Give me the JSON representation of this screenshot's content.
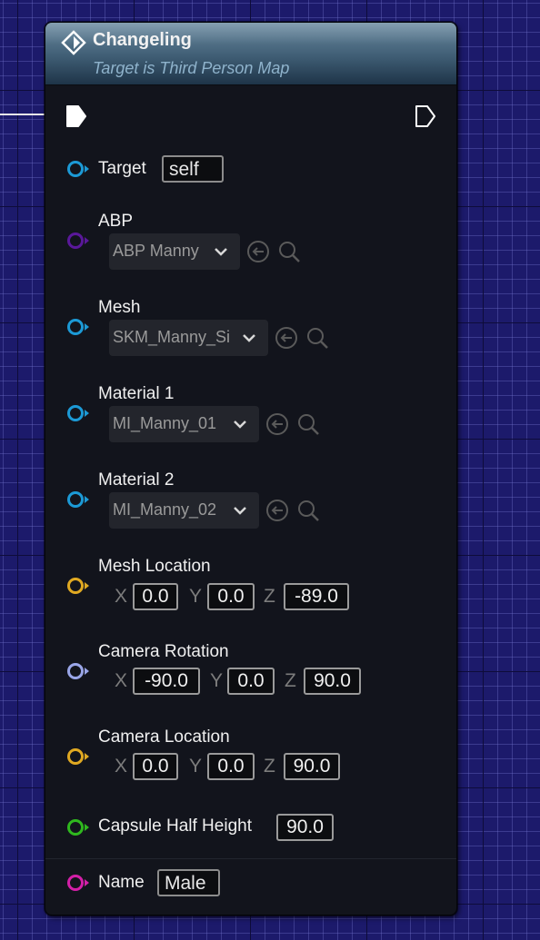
{
  "node": {
    "title": "Changeling",
    "subtitle": "Target is Third Person Map",
    "icon": "function-diamond-icon",
    "header_color": "#3f5d74"
  },
  "pins": {
    "target": {
      "label": "Target",
      "value": "self",
      "color": "#1c9ad6"
    },
    "abp": {
      "label": "ABP",
      "value": "ABP Manny",
      "color": "#5a189a"
    },
    "mesh": {
      "label": "Mesh",
      "value": "SKM_Manny_Si",
      "color": "#1c9ad6"
    },
    "material1": {
      "label": "Material 1",
      "value": "MI_Manny_01",
      "color": "#1c9ad6"
    },
    "material2": {
      "label": "Material 2",
      "value": "MI_Manny_02",
      "color": "#1c9ad6"
    },
    "mesh_location": {
      "label": "Mesh Location",
      "color": "#e0a922",
      "x_label": "X",
      "x": "0.0",
      "y_label": "Y",
      "y": "0.0",
      "z_label": "Z",
      "z": "-89.0"
    },
    "camera_rotation": {
      "label": "Camera Rotation",
      "color": "#9aa6e8",
      "x_label": "X",
      "x": "-90.0",
      "y_label": "Y",
      "y": "0.0",
      "z_label": "Z",
      "z": "90.0"
    },
    "camera_location": {
      "label": "Camera Location",
      "color": "#e0a922",
      "x_label": "X",
      "x": "0.0",
      "y_label": "Y",
      "y": "0.0",
      "z_label": "Z",
      "z": "90.0"
    },
    "capsule_half_height": {
      "label": "Capsule Half Height",
      "value": "90.0",
      "color": "#2fb81e"
    },
    "name": {
      "label": "Name",
      "value": "Male",
      "color": "#d41fa8"
    }
  },
  "colors": {
    "background": "#1c1a6b",
    "node_body": "#12141c",
    "exec_pin": "#ffffff"
  }
}
